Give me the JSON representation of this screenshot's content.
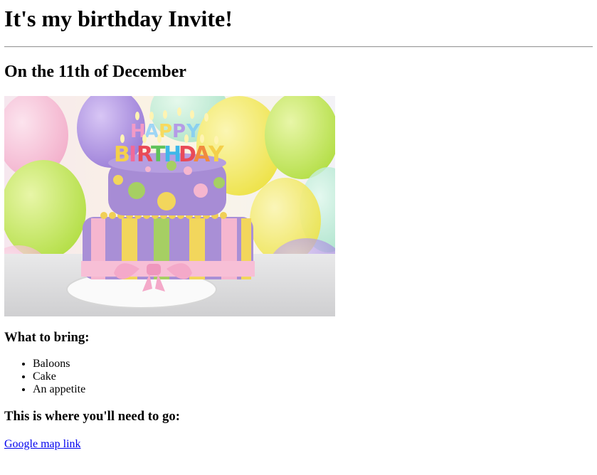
{
  "heading": "It's my birthday Invite!",
  "date_heading": "On the 11th of December",
  "image": {
    "description_icon": "birthday-cake-image",
    "candle_text": [
      "HAPPY",
      "BIRTHDAY"
    ]
  },
  "bring": {
    "heading": "What to bring:",
    "items": [
      "Baloons",
      "Cake",
      "An appetite"
    ]
  },
  "where": {
    "heading": "This is where you'll need to go:",
    "link_label": "Google map link"
  },
  "colors": {
    "link": "#0000ee",
    "cake_lavender": "#a98fd6",
    "cake_pink": "#f5b6cf",
    "cake_yellow": "#f2d65c",
    "cake_green": "#a6cf63"
  }
}
